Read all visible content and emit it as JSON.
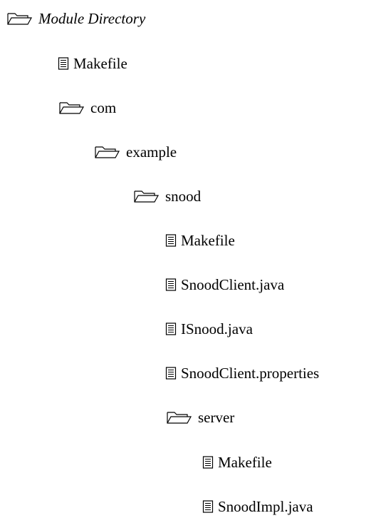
{
  "tree": [
    {
      "label": "Module Directory",
      "icon": "folder-icon"
    },
    {
      "label": "Makefile",
      "icon": "file-icon"
    },
    {
      "label": "com",
      "icon": "folder-icon"
    },
    {
      "label": "example",
      "icon": "folder-icon"
    },
    {
      "label": "snood",
      "icon": "folder-icon"
    },
    {
      "label": "Makefile",
      "icon": "file-icon"
    },
    {
      "label": "SnoodClient.java",
      "icon": "file-icon"
    },
    {
      "label": "ISnood.java",
      "icon": "file-icon"
    },
    {
      "label": "SnoodClient.properties",
      "icon": "file-icon"
    },
    {
      "label": "server",
      "icon": "folder-icon"
    },
    {
      "label": "Makefile",
      "icon": "file-icon"
    },
    {
      "label": "SnoodImpl.java",
      "icon": "file-icon"
    }
  ]
}
